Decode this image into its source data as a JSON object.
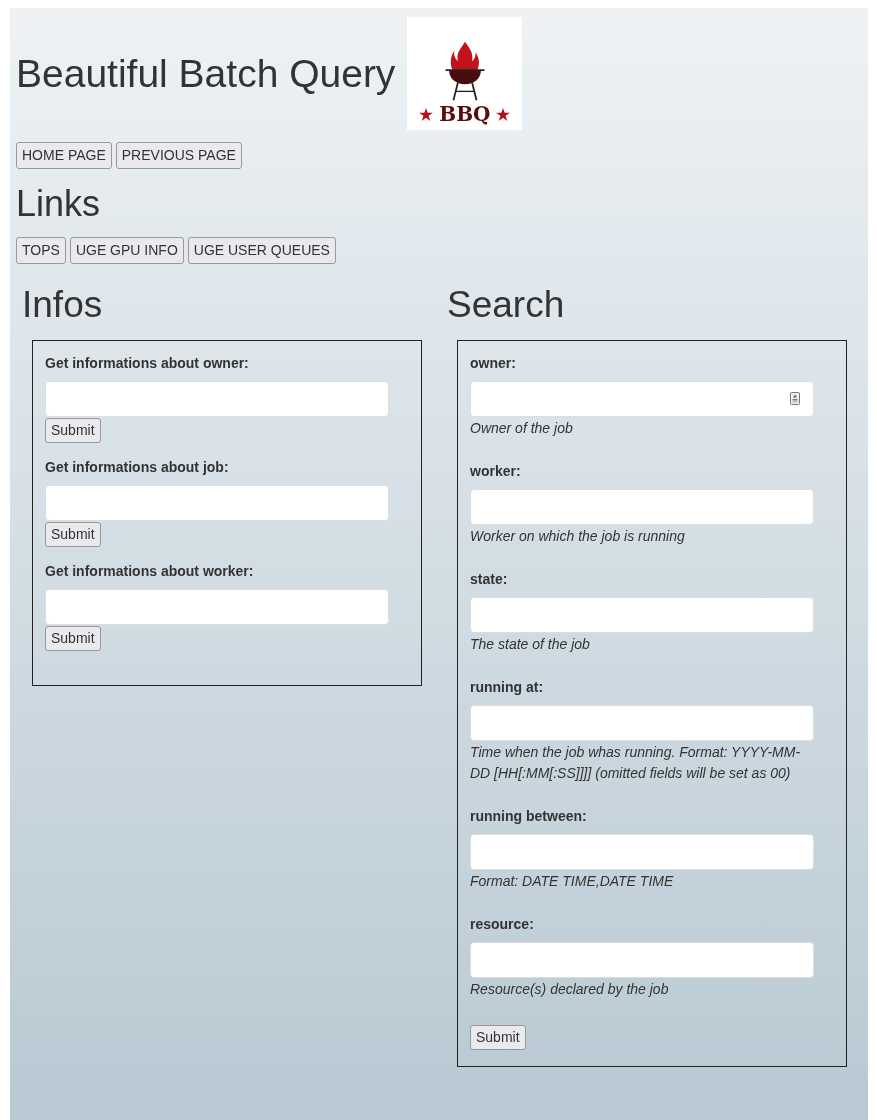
{
  "title": "Beautiful Batch Query",
  "logo": {
    "text": "BBQ"
  },
  "nav_buttons": [
    "HOME PAGE",
    "PREVIOUS PAGE"
  ],
  "links_heading": "Links",
  "link_buttons": [
    "TOPS",
    "UGE GPU INFO",
    "UGE USER QUEUES"
  ],
  "infos": {
    "heading": "Infos",
    "forms": [
      {
        "label": "Get informations about owner:",
        "button": "Submit"
      },
      {
        "label": "Get informations about job:",
        "button": "Submit"
      },
      {
        "label": "Get informations about worker:",
        "button": "Submit"
      }
    ]
  },
  "search": {
    "heading": "Search",
    "fields": [
      {
        "label": "owner:",
        "hint": "Owner of the job",
        "contact_icon": true
      },
      {
        "label": "worker:",
        "hint": "Worker on which the job is running",
        "contact_icon": false
      },
      {
        "label": "state:",
        "hint": "The state of the job",
        "contact_icon": false
      },
      {
        "label": "running at:",
        "hint": "Time when the job whas running. Format: YYYY-MM-DD [HH[:MM[:SS]]]] (omitted fields will be set as 00)",
        "contact_icon": false
      },
      {
        "label": "running between:",
        "hint": "Format: DATE TIME,DATE TIME",
        "contact_icon": false
      },
      {
        "label": "resource:",
        "hint": "Resource(s) declared by the job",
        "contact_icon": false
      }
    ],
    "button": "Submit"
  }
}
